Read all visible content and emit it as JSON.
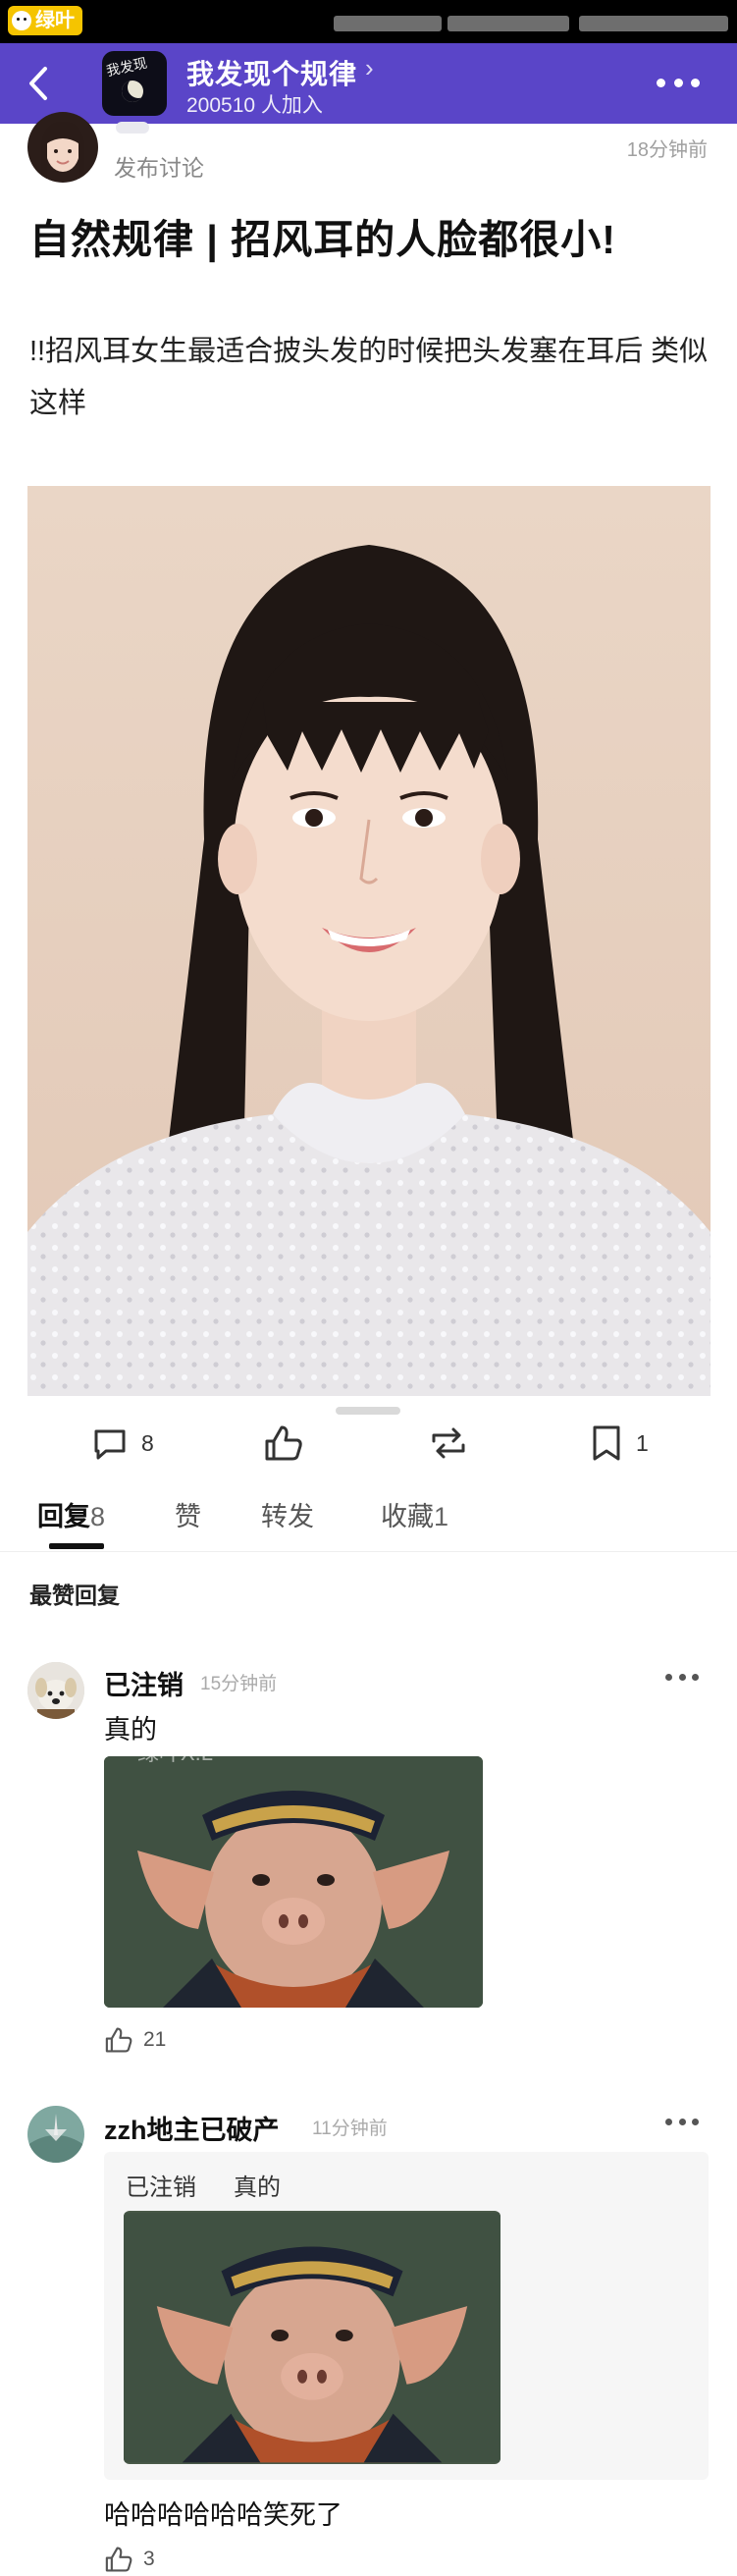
{
  "status": {
    "app_badge": "绿叶"
  },
  "group": {
    "name": "我发现个规律",
    "members": "200510 人加入",
    "avatar_text": "我发现"
  },
  "post": {
    "type": "发布讨论",
    "time": "18分钟前",
    "title": "自然规律 | 招风耳的人脸都很小!",
    "body": "!!招风耳女生最适合披头发的时候把头发塞在耳后 类似这样"
  },
  "actions": {
    "comments": "8",
    "retweet": "",
    "bookmarks": "1"
  },
  "tabs": [
    {
      "label": "回复",
      "count": "8"
    },
    {
      "label": "赞",
      "count": ""
    },
    {
      "label": "转发",
      "count": ""
    },
    {
      "label": "收藏",
      "count": "1"
    }
  ],
  "section_label": "最赞回复",
  "comments": [
    {
      "user": "已注销",
      "time": "15分钟前",
      "text": "真的",
      "likes": "21"
    },
    {
      "user": "zzh地主已破产",
      "time": "11分钟前",
      "quote_user": "已注销",
      "quote_text": "真的",
      "text": "哈哈哈哈哈哈笑死了",
      "likes": "3"
    }
  ],
  "watermark": "绿叶X.L",
  "colors": {
    "header": "#5a45c8",
    "badge": "#f5c400"
  },
  "icons": [
    "back-icon",
    "more-icon",
    "comment-icon",
    "like-icon",
    "retweet-icon",
    "bookmark-icon"
  ]
}
